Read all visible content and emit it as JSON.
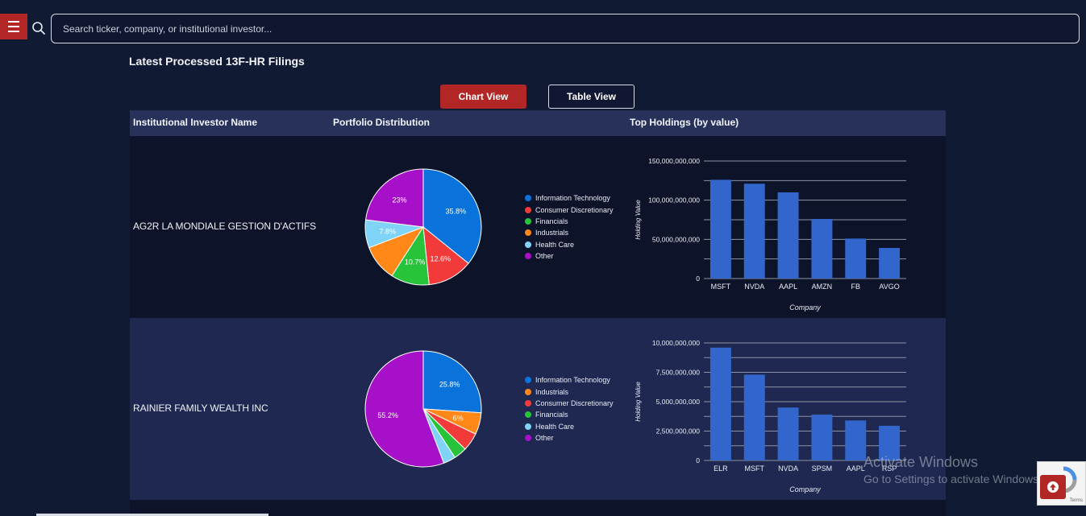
{
  "search": {
    "placeholder": "Search ticker, company, or institutional investor..."
  },
  "page": {
    "title": "Latest Processed 13F-HR Filings"
  },
  "views": {
    "chart_label": "Chart View",
    "table_label": "Table View",
    "active": "chart"
  },
  "table": {
    "headers": {
      "investor": "Institutional Investor Name",
      "distribution": "Portfolio Distribution",
      "holdings": "Top Holdings (by value)"
    }
  },
  "sector_colors": {
    "Information Technology": "#0a73db",
    "Consumer Discretionary": "#f23a3a",
    "Financials": "#27c33a",
    "Industrials": "#ff8819",
    "Health Care": "#7fd3f7",
    "Other": "#a710c9"
  },
  "rows": [
    {
      "investor": "AG2R LA MONDIALE GESTION D'ACTIFS",
      "pie": {
        "type": "pie",
        "labels": [
          "Information Technology",
          "Consumer Discretionary",
          "Financials",
          "Industrials",
          "Health Care",
          "Other"
        ],
        "values": [
          35.8,
          12.6,
          10.7,
          10.1,
          7.8,
          23
        ],
        "value_labels": [
          "35.8%",
          "12.6%",
          "10.7%",
          "",
          "7.8%",
          "23%"
        ]
      },
      "bars": {
        "type": "bar",
        "categories": [
          "MSFT",
          "NVDA",
          "AAPL",
          "AMZN",
          "FB",
          "AVGO"
        ],
        "values": [
          126000000000,
          121000000000,
          110000000000,
          76000000000,
          51000000000,
          39000000000
        ],
        "ticks": [
          "0",
          "50,000,000,000",
          "100,000,000,000",
          "150,000,000,000"
        ],
        "ylim": [
          0,
          150000000000
        ],
        "tick_step": 25000000000,
        "xlabel": "Company",
        "ylabel": "Holding Value"
      }
    },
    {
      "investor": "RAINIER FAMILY WEALTH INC",
      "pie": {
        "type": "pie",
        "labels": [
          "Information Technology",
          "Industrials",
          "Consumer Discretionary",
          "Financials",
          "Health Care",
          "Other"
        ],
        "values": [
          25.8,
          6,
          5,
          3.6,
          3.4,
          55.2
        ],
        "value_labels": [
          "25.8%",
          "6%",
          "",
          "",
          "",
          "55.2%"
        ]
      },
      "bars": {
        "type": "bar",
        "categories": [
          "ELR",
          "MSFT",
          "NVDA",
          "SPSM",
          "AAPL",
          "RSP"
        ],
        "values": [
          9600000000,
          7300000000,
          4500000000,
          3900000000,
          3400000000,
          2950000000
        ],
        "ticks": [
          "0",
          "2,500,000,000",
          "5,000,000,000",
          "7,500,000,000",
          "10,000,000,000"
        ],
        "ylim": [
          0,
          10000000000
        ],
        "tick_step": 1250000000,
        "xlabel": "Company",
        "ylabel": "Holding Value"
      }
    }
  ],
  "watermark": {
    "line1": "Activate Windows",
    "line2": "Go to Settings to activate Windows."
  },
  "recaptcha": {
    "terms": "Terms"
  }
}
